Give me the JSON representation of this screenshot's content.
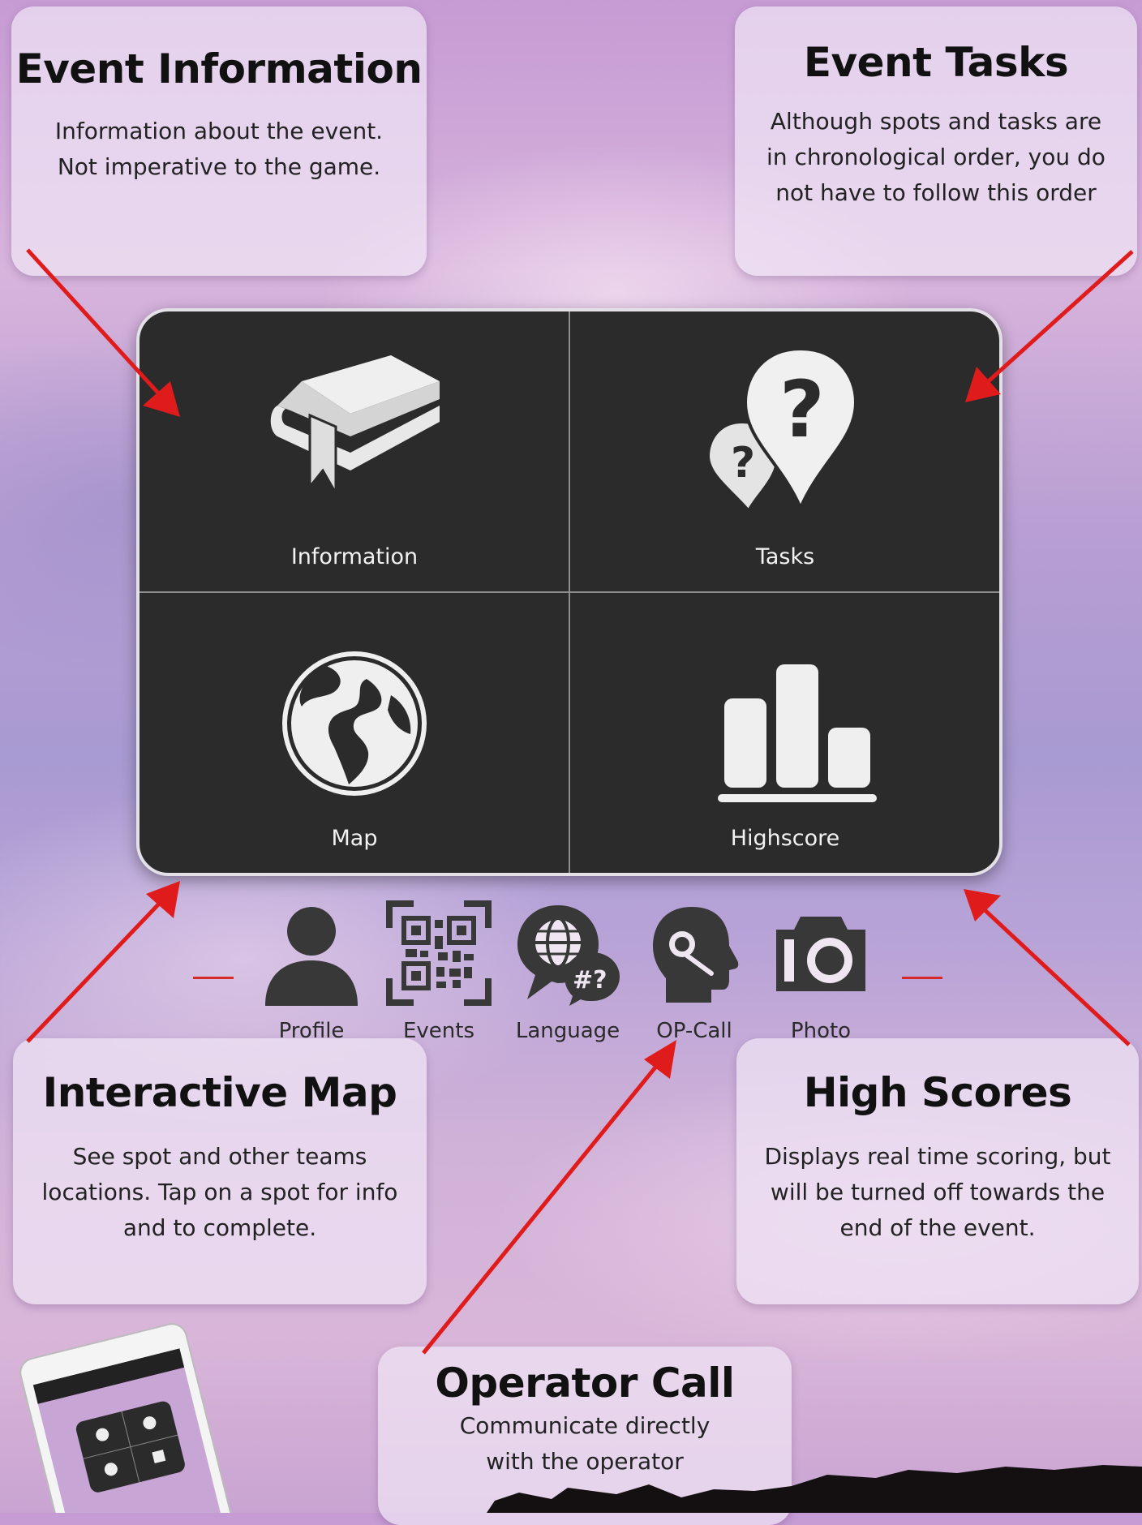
{
  "callouts": {
    "event_information": {
      "title": "Event Information",
      "line1": "Information about the event.",
      "line2": "Not imperative to the game."
    },
    "event_tasks": {
      "title": "Event Tasks",
      "line1": "Although spots and tasks are",
      "line2": "in chronological order, you do",
      "line3": "not have to follow this order"
    },
    "interactive_map": {
      "title": "Interactive Map",
      "line1": "See spot and other teams",
      "line2": "locations. Tap on a spot for info",
      "line3": "and to complete."
    },
    "high_scores": {
      "title": "High Scores",
      "line1": "Displays real time scoring, but",
      "line2": "will be turned off towards the",
      "line3": "end of the event."
    },
    "operator_call": {
      "title": "Operator Call",
      "line1": "Communicate directly",
      "line2": "with the operator"
    }
  },
  "menu": {
    "tiles": [
      {
        "label": "Information",
        "icon": "book-icon"
      },
      {
        "label": "Tasks",
        "icon": "question-pin-icon"
      },
      {
        "label": "Map",
        "icon": "globe-icon"
      },
      {
        "label": "Highscore",
        "icon": "bar-chart-icon"
      }
    ]
  },
  "toolbar": {
    "items": [
      {
        "label": "Profile",
        "icon": "person-icon"
      },
      {
        "label": "Events",
        "icon": "qr-code-icon"
      },
      {
        "label": "Language",
        "icon": "language-globe-icon"
      },
      {
        "label": "OP-Call",
        "icon": "headset-icon"
      },
      {
        "label": "Photo",
        "icon": "camera-icon"
      }
    ]
  },
  "colors": {
    "panel": "#2b2b2c",
    "arrow": "#e01b1b",
    "callout_bg": "#f0e4f5"
  }
}
